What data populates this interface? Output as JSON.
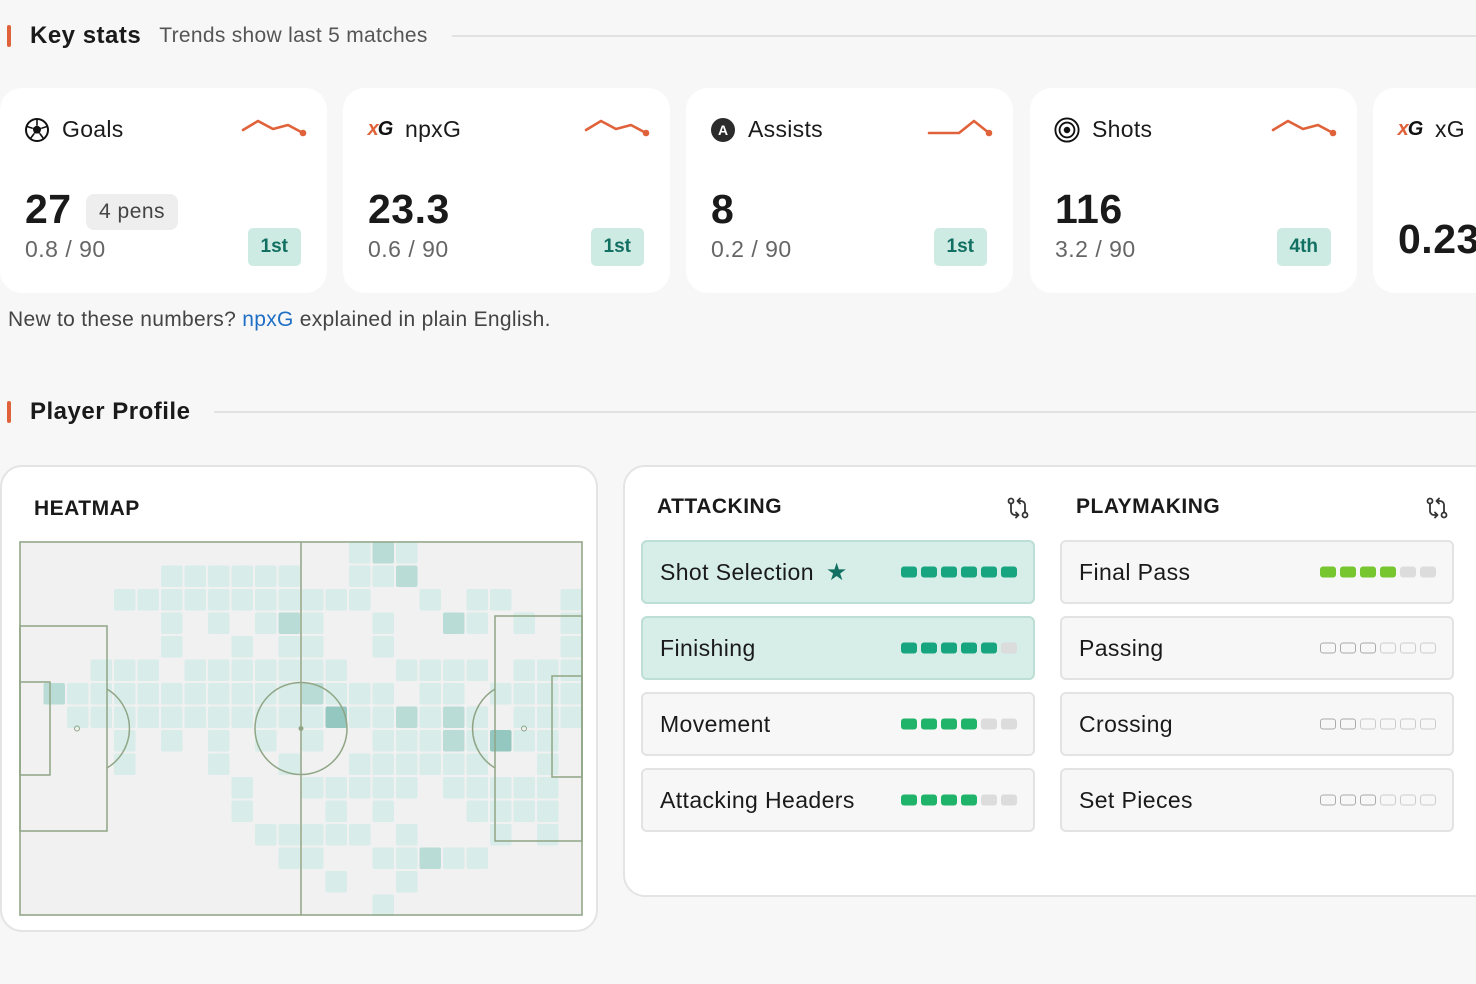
{
  "key_stats": {
    "title": "Key stats",
    "subtitle": "Trends show last 5 matches",
    "cards": [
      {
        "label": "Goals",
        "icon": "football-icon",
        "value": "27",
        "badge": "4 pens",
        "per90": "0.8 / 90",
        "rank": "1st",
        "trend": [
          0.6,
          0.15,
          0.55,
          0.35,
          0.75
        ]
      },
      {
        "label": "npxG",
        "icon": "xg-icon",
        "value": "23.3",
        "per90": "0.6 / 90",
        "rank": "1st",
        "trend": [
          0.6,
          0.15,
          0.55,
          0.35,
          0.75
        ]
      },
      {
        "label": "Assists",
        "icon": "assist-icon",
        "value": "8",
        "per90": "0.2 / 90",
        "rank": "1st",
        "trend": [
          0.75,
          0.75,
          0.75,
          0.15,
          0.75
        ]
      },
      {
        "label": "Shots",
        "icon": "target-icon",
        "value": "116",
        "per90": "3.2 / 90",
        "rank": "4th",
        "trend": [
          0.6,
          0.15,
          0.55,
          0.35,
          0.75
        ]
      },
      {
        "label": "xG",
        "icon": "xg-icon",
        "value": "0.23",
        "per90": "",
        "rank": "",
        "trend": []
      }
    ],
    "xg_icon_text": {
      "x": "x",
      "g": "G"
    },
    "assist_letter": "A"
  },
  "explainer": {
    "prefix": "New to these numbers?",
    "link": "npxG",
    "suffix": "explained in plain English."
  },
  "player_profile": {
    "title": "Player Profile",
    "heatmap_title": "HEATMAP",
    "attacking": {
      "title": "ATTACKING",
      "skills": [
        {
          "name": "Shot Selection",
          "level": 6,
          "max": 6,
          "highlight": true,
          "star": true,
          "color": "teal"
        },
        {
          "name": "Finishing",
          "level": 5,
          "max": 6,
          "highlight": true,
          "star": false,
          "color": "teal"
        },
        {
          "name": "Movement",
          "level": 4,
          "max": 6,
          "highlight": false,
          "star": false,
          "color": "green"
        },
        {
          "name": "Attacking Headers",
          "level": 4,
          "max": 6,
          "highlight": false,
          "star": false,
          "color": "green"
        }
      ]
    },
    "playmaking": {
      "title": "PLAYMAKING",
      "skills": [
        {
          "name": "Final Pass",
          "level": 4,
          "max": 6,
          "highlight": false,
          "star": false,
          "color": "lime"
        },
        {
          "name": "Passing",
          "level": 3,
          "max": 6,
          "highlight": false,
          "star": false,
          "color": "empty"
        },
        {
          "name": "Crossing",
          "level": 2,
          "max": 6,
          "highlight": false,
          "star": false,
          "color": "empty"
        },
        {
          "name": "Set Pieces",
          "level": 3,
          "max": 6,
          "highlight": false,
          "star": false,
          "color": "empty"
        }
      ]
    },
    "star_glyph": "★"
  },
  "colors": {
    "accent": "#e0623a",
    "rank_bg": "#cdeae3",
    "rank_text": "#127062",
    "link": "#1f6fc4",
    "pitch_line": "#8fa585",
    "heat_light": "#d8ece9",
    "heat_mid": "#b9dcd6",
    "heat_dark": "#94c7bf"
  }
}
